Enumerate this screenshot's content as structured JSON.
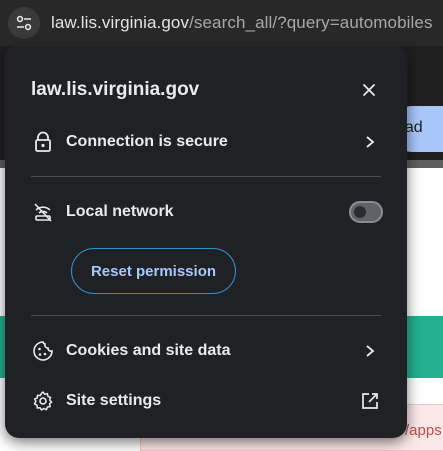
{
  "browser": {
    "url_host": "law.lis.virginia.gov",
    "url_path": "/search_all/?query=automobiles",
    "site_info_icon": "tune-icon"
  },
  "background": {
    "button_fragment": "oad",
    "pink_text_fragment": "/apps"
  },
  "popup": {
    "title": "law.lis.virginia.gov",
    "close_icon": "close-icon",
    "connection": {
      "label": "Connection is secure",
      "icon": "lock-icon",
      "trail_icon": "chevron-right-icon"
    },
    "local_network": {
      "label": "Local network",
      "icon": "network-off-icon",
      "toggle_on": false
    },
    "reset_permission": {
      "label": "Reset permission"
    },
    "cookies": {
      "label": "Cookies and site data",
      "icon": "cookie-icon",
      "trail_icon": "chevron-right-icon"
    },
    "site_settings": {
      "label": "Site settings",
      "icon": "gear-icon",
      "trail_icon": "open-external-icon"
    }
  },
  "colors": {
    "popup_bg": "#202124",
    "accent": "#a8c7fa",
    "teal": "#24b091"
  }
}
